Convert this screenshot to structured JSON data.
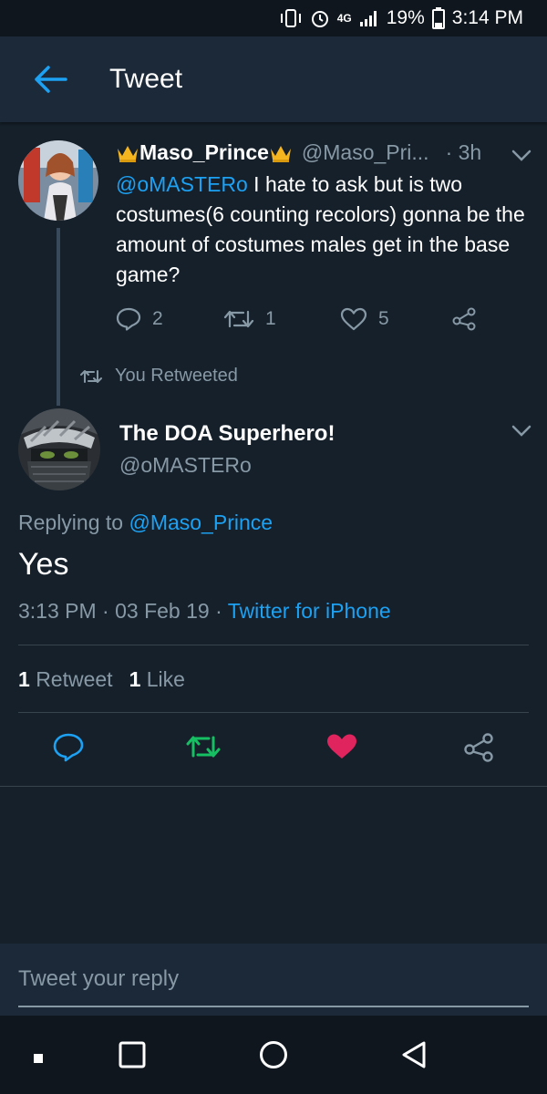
{
  "status_bar": {
    "network": "4G",
    "battery": "19%",
    "time": "3:14 PM"
  },
  "app_bar": {
    "title": "Tweet",
    "back_icon": "arrow-left-icon"
  },
  "original_tweet": {
    "display_name": "Maso_Prince",
    "handle": "@Maso_Pri...",
    "time": "· 3h",
    "mention": "@oMASTERo",
    "text": " I hate to ask but is two costumes(6 counting recolors) gonna be the amount of costumes males get in the base game?",
    "replies": "2",
    "retweets": "1",
    "likes": "5"
  },
  "retweet_notice": "You Retweeted",
  "main_tweet": {
    "display_name": "The DOA Superhero!",
    "handle": "@oMASTERo",
    "replying_prefix": "Replying to ",
    "replying_to": "@Maso_Prince",
    "text": "Yes",
    "timestamp": "3:13 PM · 03 Feb 19 · ",
    "source": "Twitter for iPhone",
    "retweet_count": "1",
    "retweet_label": "Retweet",
    "like_count": "1",
    "like_label": "Like"
  },
  "reply_box": {
    "placeholder": "Tweet your reply"
  },
  "colors": {
    "accent": "#1da1f2",
    "retweet_green": "#17bf63",
    "like_red": "#e0245e",
    "background": "#15202b",
    "muted": "#8899a6"
  }
}
